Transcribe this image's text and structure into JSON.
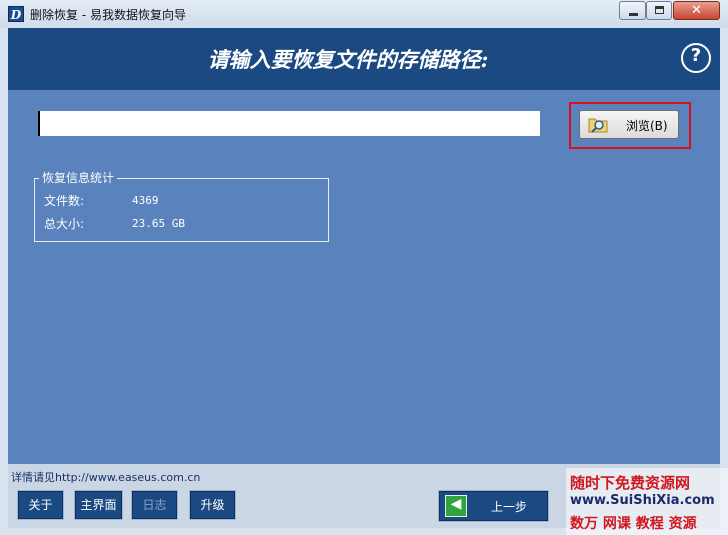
{
  "window": {
    "app_icon": "D",
    "title": "删除恢复 - 易我数据恢复向导",
    "close_glyph": "✕"
  },
  "banner": {
    "title": "请输入要恢复文件的存储路径:",
    "help_label": "?"
  },
  "path_input": {
    "value": "",
    "placeholder": ""
  },
  "browse": {
    "label": "浏览(B)",
    "icon": "folder-search-icon"
  },
  "stats": {
    "legend": "恢复信息统计",
    "file_count_label": "文件数:",
    "file_count_value": "4369",
    "total_size_label": "总大小:",
    "total_size_value": "23.65 GB"
  },
  "footer": {
    "link": "详情请见http://www.easeus.com.cn",
    "about": "关于",
    "main_ui": "主界面",
    "log": "日志",
    "upgrade": "升级",
    "prev": "上一步",
    "prev_icon": "arrow-left-icon"
  },
  "watermark": {
    "line1": "随时下免费资源网",
    "line2": "www.SuiShiXia.com",
    "line3": "数万 网课 教程 资源"
  },
  "colors": {
    "banner": "#1b4a83",
    "main_bg": "#5a82bd",
    "highlight_border": "#d8101a",
    "prev_icon": "#2fa53c"
  }
}
